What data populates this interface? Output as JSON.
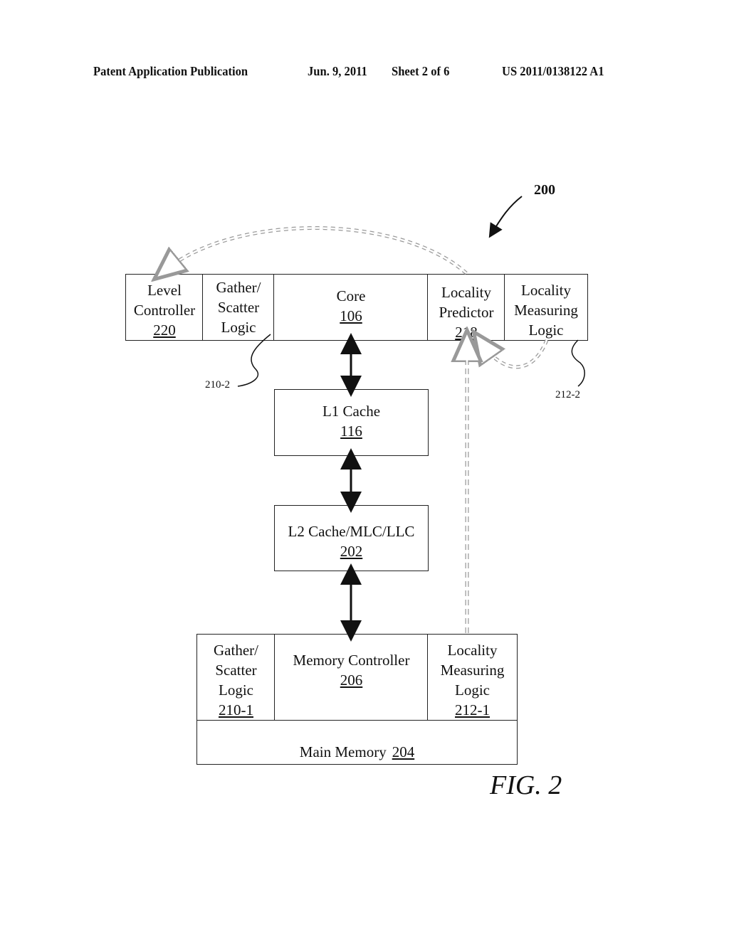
{
  "header": {
    "publication": "Patent Application Publication",
    "date": "Jun. 9, 2011",
    "sheet": "Sheet 2 of 6",
    "number": "US 2011/0138122 A1"
  },
  "figure": {
    "ref_number": "200",
    "label": "FIG. 2"
  },
  "top_row": {
    "level_controller": {
      "lines": [
        "Level",
        "Controller"
      ],
      "num": "220"
    },
    "gather_scatter": {
      "lines": [
        "Gather/",
        "Scatter",
        "Logic"
      ]
    },
    "core": {
      "lines": [
        "Core"
      ],
      "num": "106"
    },
    "locality_predictor": {
      "lines": [
        "Locality",
        "Predictor"
      ],
      "num": "218"
    },
    "locality_measuring": {
      "lines": [
        "Locality",
        "Measuring",
        "Logic"
      ]
    }
  },
  "l1_cache": {
    "lines": [
      "L1 Cache"
    ],
    "num": "116"
  },
  "l2_cache": {
    "lines": [
      "L2 Cache/MLC/LLC"
    ],
    "num": "202"
  },
  "bottom_row": {
    "gather_scatter": {
      "lines": [
        "Gather/",
        "Scatter",
        "Logic"
      ],
      "num": "210-1"
    },
    "memory_controller": {
      "lines": [
        "Memory Controller"
      ],
      "num": "206"
    },
    "locality_measuring": {
      "lines": [
        "Locality",
        "Measuring",
        "Logic"
      ],
      "num": "212-1"
    },
    "main_memory": {
      "label": "Main Memory",
      "num": "204"
    }
  },
  "callouts": {
    "gather_scatter_top": "210-2",
    "locality_measuring_top": "212-2"
  }
}
